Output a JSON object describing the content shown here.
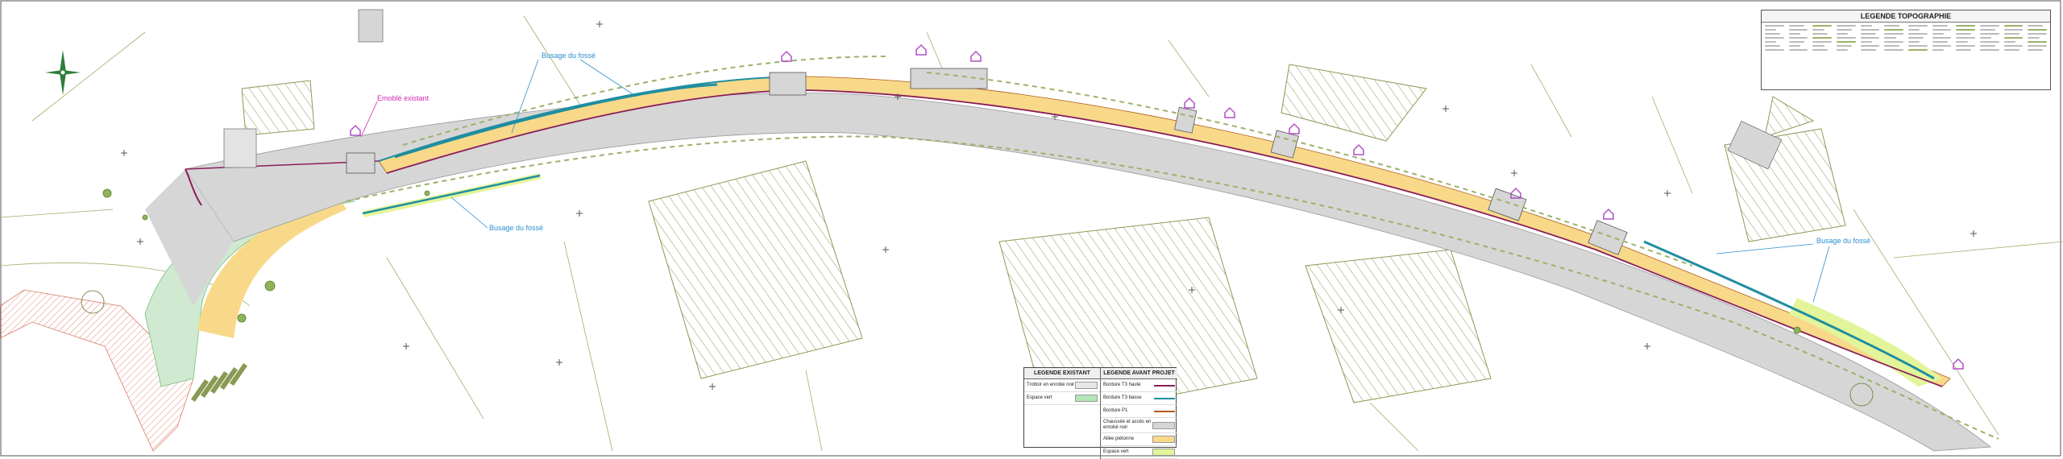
{
  "legend_topo": {
    "title": "LEGENDE TOPOGRAPHIE"
  },
  "labels": {
    "busage_1": "Busage du fossé",
    "busage_2": "Busage du fossé",
    "busage_3": "Busage du fossé",
    "emoble": "Emoblé existant"
  },
  "legend_existing": {
    "title": "LEGENDE EXISTANT",
    "items": [
      {
        "label": "Trottoir en enrobé noir",
        "color": "#e8e8e8"
      },
      {
        "label": "Espace vert",
        "color": "#b5e6b8"
      }
    ]
  },
  "legend_project": {
    "title": "LEGENDE AVANT PROJET",
    "items": [
      {
        "label": "Bordure T3 haute",
        "color": "#8a1d5a",
        "kind": "line"
      },
      {
        "label": "Bordure T3 basse",
        "color": "#1f8ea0",
        "kind": "line"
      },
      {
        "label": "Bordure P1",
        "color": "#b25a1d",
        "kind": "line"
      },
      {
        "label": "Chaussée et accès en enrobé noir",
        "color": "#d6d6d6",
        "kind": "fill"
      },
      {
        "label": "Allée piétonne",
        "color": "#f8d98a",
        "kind": "fill"
      },
      {
        "label": "Espace vert",
        "color": "#e2f59a",
        "kind": "fill"
      }
    ]
  },
  "colors": {
    "road": "#d6d6d6",
    "sidewalk": "#f8d98a",
    "green": "#e2f59a",
    "existing_green": "#cfead0",
    "curb_high": "#8a1d5a",
    "curb_low": "#1f8ea0",
    "curb_p1": "#b25a1d",
    "topo": "#9bb26a",
    "annotation_blue": "#2b8fd0",
    "annotation_magenta": "#d12bb3",
    "hatch": "#8a9a55"
  }
}
